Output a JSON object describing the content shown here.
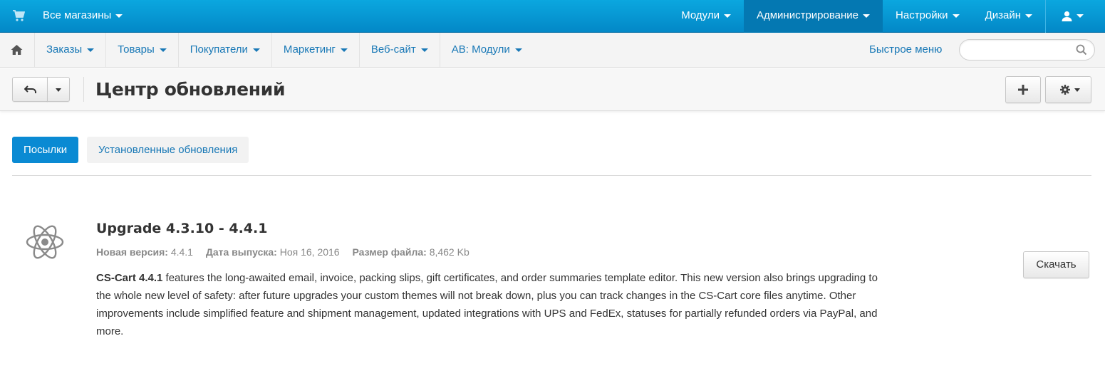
{
  "topbar": {
    "stores_label": "Все магазины",
    "nav": [
      {
        "label": "Модули"
      },
      {
        "label": "Администрирование"
      },
      {
        "label": "Настройки"
      },
      {
        "label": "Дизайн"
      }
    ]
  },
  "menubar": {
    "menus": [
      {
        "label": "Заказы"
      },
      {
        "label": "Товары"
      },
      {
        "label": "Покупатели"
      },
      {
        "label": "Маркетинг"
      },
      {
        "label": "Веб-сайт"
      },
      {
        "label": "AB: Модули"
      }
    ],
    "quick_menu": "Быстрое меню",
    "search_placeholder": ""
  },
  "page": {
    "title": "Центр обновлений"
  },
  "tabs": [
    {
      "label": "Посылки",
      "active": true
    },
    {
      "label": "Установленные обновления",
      "active": false
    }
  ],
  "package": {
    "title": "Upgrade 4.3.10 - 4.4.1",
    "new_version_label": "Новая версия:",
    "new_version": "4.4.1",
    "release_date_label": "Дата выпуска:",
    "release_date": "Ноя 16, 2016",
    "file_size_label": "Размер файла:",
    "file_size": "8,462 Kb",
    "desc_strong": "CS-Cart 4.4.1",
    "desc_rest": " features the long-awaited email, invoice, packing slips, gift certificates, and order summaries template editor. This new version also brings upgrading to the whole new level of safety: after future upgrades your custom themes will not break down, plus you can track changes in the CS-Cart core files anytime. Other improvements include simplified feature and shipment management, updated integrations with UPS and FedEx, statuses for partially refunded orders via PayPal, and more.",
    "download_label": "Скачать"
  },
  "icons": {
    "cart": "cart-icon",
    "user": "user-icon",
    "home": "home-icon",
    "search": "search-icon",
    "back": "back-arrow-icon",
    "add": "plus-icon",
    "gear": "gear-icon",
    "package": "atom-icon"
  },
  "colors": {
    "topbar": "#0ba7df",
    "active_tab": "#0a8ad3",
    "link": "#1878b6"
  }
}
